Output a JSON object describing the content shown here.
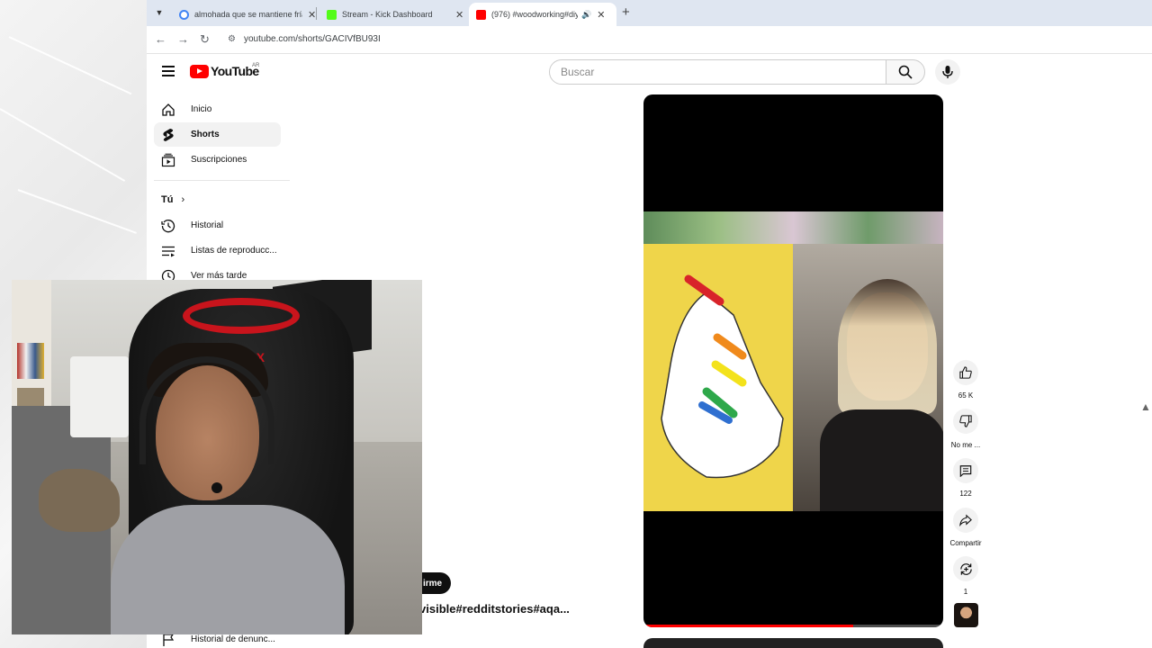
{
  "browser": {
    "tabs": [
      {
        "title": "almohada que se mantiene fría",
        "favicon_color": "#4285f4"
      },
      {
        "title": "Stream - Kick Dashboard",
        "favicon_color": "#53fc18"
      },
      {
        "title": "(976) #woodworking#diy#",
        "favicon_color": "#ff0000"
      }
    ],
    "url": "youtube.com/shorts/GACIVfBU93I"
  },
  "youtube": {
    "logo_text": "YouTube",
    "country_code": "AR",
    "search_placeholder": "Buscar"
  },
  "sidebar": {
    "items": [
      {
        "label": "Inicio",
        "icon": "home-icon"
      },
      {
        "label": "Shorts",
        "icon": "shorts-icon"
      },
      {
        "label": "Suscripciones",
        "icon": "subscriptions-icon"
      }
    ],
    "you_label": "Tú",
    "you_items": [
      {
        "label": "Historial",
        "icon": "history-icon"
      },
      {
        "label": "Listas de reproducc...",
        "icon": "playlists-icon"
      },
      {
        "label": "Ver más tarde",
        "icon": "watch-later-icon"
      }
    ],
    "bottom_item": {
      "label": "Historial de denunc...",
      "icon": "flag-icon"
    }
  },
  "short": {
    "progress": 0.7,
    "subscribe_label": "irme",
    "description": "y#invisible#redditstories#aqa..."
  },
  "actions": {
    "like_count": "65 K",
    "dislike_label": "No me ...",
    "comment_count": "122",
    "share_label": "Compartir",
    "remix_count": "1"
  },
  "webcam": {
    "chair_brand": "MAX"
  },
  "colors": {
    "youtube_red": "#ff0000",
    "accent_red": "#c8141c"
  }
}
